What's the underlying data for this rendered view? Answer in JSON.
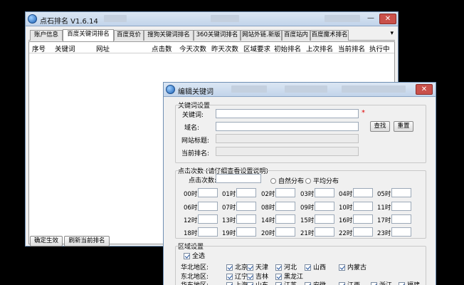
{
  "main_window": {
    "title": "点石排名 V1.6.14",
    "min_label": "—",
    "close_label": "✕",
    "tabs": [
      "账户信息",
      "百度关键词排名",
      "百度竞价",
      "搜狗关键词排名",
      "360关键词排名",
      "网站外链.新版",
      "百度站内",
      "百度魔术排名"
    ],
    "tab_menu_icon": "▾",
    "columns": [
      "序号",
      "关键词",
      "网址",
      "点击数",
      "今天次数",
      "昨天次数",
      "区域要求",
      "初始排名",
      "上次排名",
      "当前排名",
      "执行中"
    ],
    "confirm_button": "确定生效",
    "refresh_button": "刷新当前排名"
  },
  "dialog": {
    "title": "编辑关键词",
    "close_label": "✕",
    "keyword_settings": {
      "group_title": "关键词设置",
      "keyword_label": "关键词:",
      "keyword_value": "",
      "required_mark": "*",
      "domain_label": "域名:",
      "domain_value": "",
      "site_title_label": "网站标题:",
      "site_title_value": "",
      "current_rank_label": "当前排名:",
      "current_rank_value": "",
      "lookup_button": "查找",
      "reset_button": "重置"
    },
    "clicks": {
      "group_title": "点击次数 (请仔细查看设置说明)",
      "clicks_label": "点击次数:",
      "clicks_value": "",
      "natural_option": "自然分布",
      "average_option": "平均分布",
      "hours": [
        "00时",
        "01时",
        "02时",
        "03时",
        "04时",
        "05时",
        "06时",
        "07时",
        "08时",
        "09时",
        "10时",
        "11时",
        "12时",
        "13时",
        "14时",
        "15时",
        "16时",
        "17时",
        "18时",
        "19时",
        "20时",
        "21时",
        "22时",
        "23时"
      ]
    },
    "region": {
      "group_title": "区域设置",
      "select_all": "全选",
      "rows": [
        {
          "label": "华北地区:",
          "items": [
            "北京",
            "天津",
            "河北",
            "山西",
            "内蒙古"
          ]
        },
        {
          "label": "东北地区:",
          "items": [
            "辽宁",
            "吉林",
            "黑龙江"
          ]
        },
        {
          "label": "华东地区:",
          "items": [
            "上海",
            "山东",
            "江苏",
            "安徽",
            "江西",
            "浙江",
            "福建"
          ]
        }
      ]
    }
  }
}
